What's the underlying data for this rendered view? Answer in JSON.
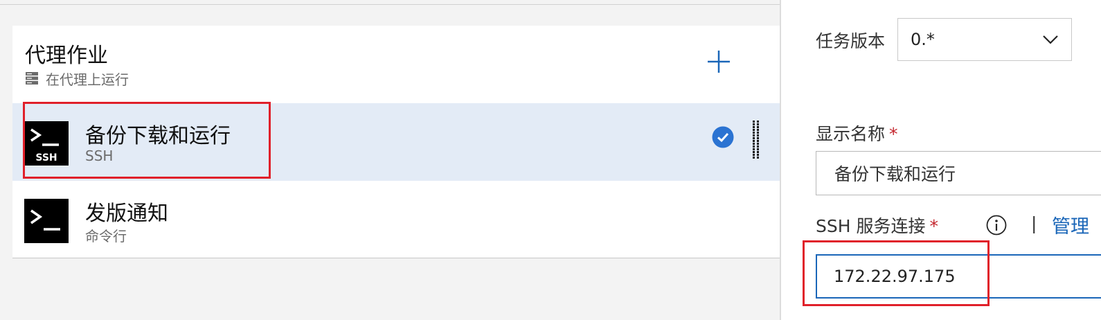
{
  "phase": {
    "title": "代理作业",
    "subtitle": "在代理上运行",
    "add_icon": "plus-icon",
    "server_icon": "server-icon"
  },
  "tasks": [
    {
      "name": "备份下载和运行",
      "type": "SSH",
      "icon": "ssh-terminal-icon",
      "icon_label": "SSH",
      "selected": true
    },
    {
      "name": "发版通知",
      "type": "命令行",
      "icon": "terminal-icon",
      "selected": false
    }
  ],
  "task_status_icon": "checkmark-circle-icon",
  "drag_icon": "drag-handle-icon",
  "properties": {
    "task_version": {
      "label": "任务版本",
      "value": "0.*"
    },
    "display_name": {
      "label": "显示名称",
      "required_mark": "*",
      "value": "备份下载和运行"
    },
    "ssh_connection": {
      "label": "SSH 服务连接",
      "required_mark": "*",
      "separator": "|",
      "manage_link": "管理",
      "value": "172.22.97.175"
    }
  },
  "colors": {
    "selected_row": "#e3ebf6",
    "accent": "#1a66b8",
    "required": "#c4262e",
    "highlight_box": "#e0202a"
  }
}
